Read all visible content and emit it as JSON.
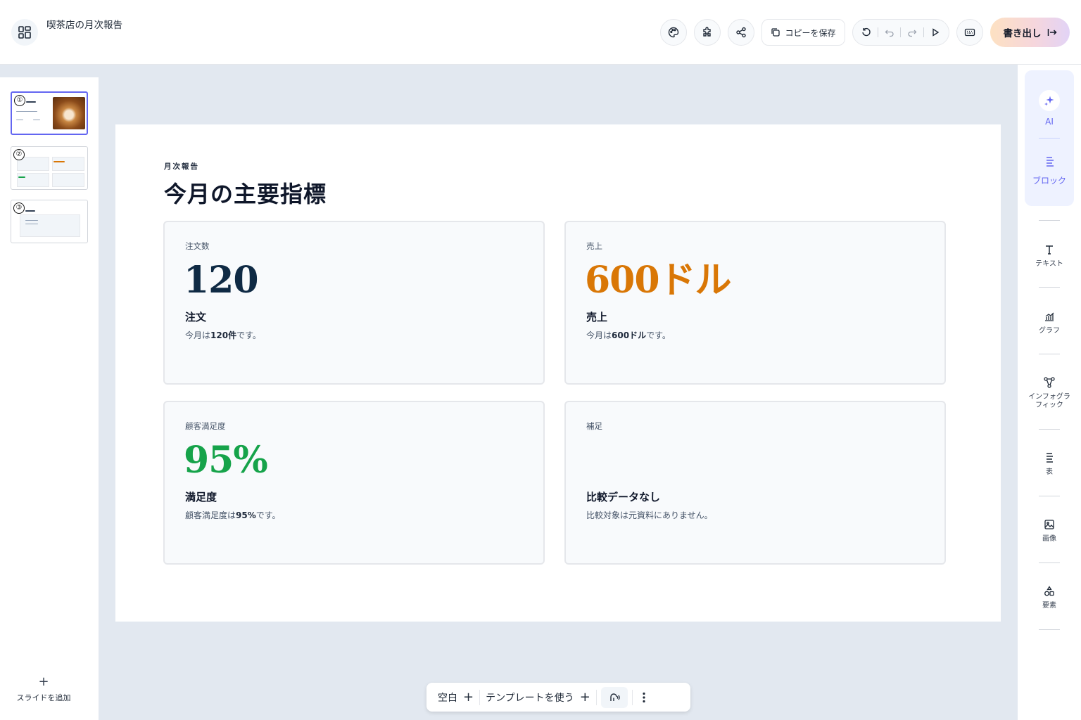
{
  "header": {
    "document_title": "喫茶店の月次報告",
    "copy_save_label": "コピーを保存",
    "export_label": "書き出し"
  },
  "slides_panel": {
    "slides": [
      {
        "number": "①"
      },
      {
        "number": "②"
      },
      {
        "number": "③"
      }
    ],
    "add_slide_label": "スライドを追加"
  },
  "tools": {
    "ai_label": "AI",
    "block_label": "ブロック",
    "text_label": "テキスト",
    "chart_label": "グラフ",
    "infographic_label": "インフォグラフィック",
    "table_label": "表",
    "image_label": "画像",
    "element_label": "要素"
  },
  "slide": {
    "eyebrow": "月次報告",
    "title": "今月の主要指標",
    "cards": [
      {
        "label": "注文数",
        "value": "120",
        "value_color": "#0f2a44",
        "subtitle": "注文",
        "desc_pre": "今月は",
        "desc_bold": "120件",
        "desc_post": "です。"
      },
      {
        "label": "売上",
        "value": "600ドル",
        "value_color": "#d97706",
        "subtitle": "売上",
        "desc_pre": "今月は",
        "desc_bold": "600ドル",
        "desc_post": "です。"
      },
      {
        "label": "顧客満足度",
        "value": "95%",
        "value_color": "#16a34a",
        "subtitle": "満足度",
        "desc_pre": "顧客満足度は",
        "desc_bold": "95%",
        "desc_post": "です。"
      },
      {
        "label": "補足",
        "value": "",
        "value_color": "#0f172a",
        "subtitle": "比較データなし",
        "desc_pre": "比較対象は元資料にありません。",
        "desc_bold": "",
        "desc_post": ""
      }
    ]
  },
  "bottom_bar": {
    "blank_label": "空白",
    "template_label": "テンプレートを使う"
  },
  "colors": {
    "accent": "#6366f1",
    "canvas_bg": "#e2e8f0"
  }
}
